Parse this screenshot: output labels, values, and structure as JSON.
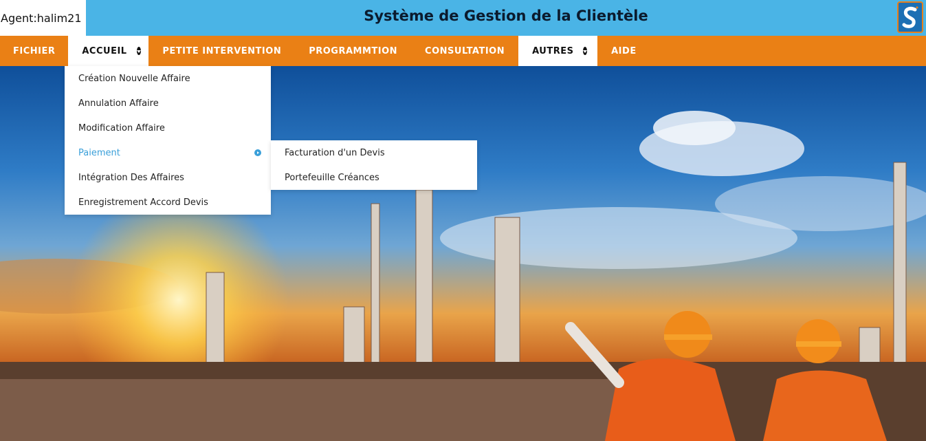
{
  "header": {
    "agent_label": "Agent:halim21",
    "title": "Système de Gestion de la Clientèle",
    "logo_letter": "S"
  },
  "nav": {
    "items": [
      {
        "label": "FICHIER"
      },
      {
        "label": "ACCUEIL"
      },
      {
        "label": "PETITE INTERVENTION"
      },
      {
        "label": "PROGRAMMTION"
      },
      {
        "label": "CONSULTATION"
      },
      {
        "label": "AUTRES"
      },
      {
        "label": "AIDE"
      }
    ]
  },
  "accueil_menu": {
    "items": [
      {
        "label": "Création Nouvelle Affaire"
      },
      {
        "label": "Annulation Affaire"
      },
      {
        "label": "Modification Affaire"
      },
      {
        "label": "Paiement"
      },
      {
        "label": "Intégration Des Affaires"
      },
      {
        "label": "Enregistrement Accord Devis"
      }
    ]
  },
  "paiement_submenu": {
    "items": [
      {
        "label": "Facturation d'un Devis"
      },
      {
        "label": "Portefeuille Créances"
      }
    ]
  },
  "colors": {
    "header_bg": "#4ab4e6",
    "nav_bg": "#ea8015",
    "highlight": "#3a9fd9"
  }
}
